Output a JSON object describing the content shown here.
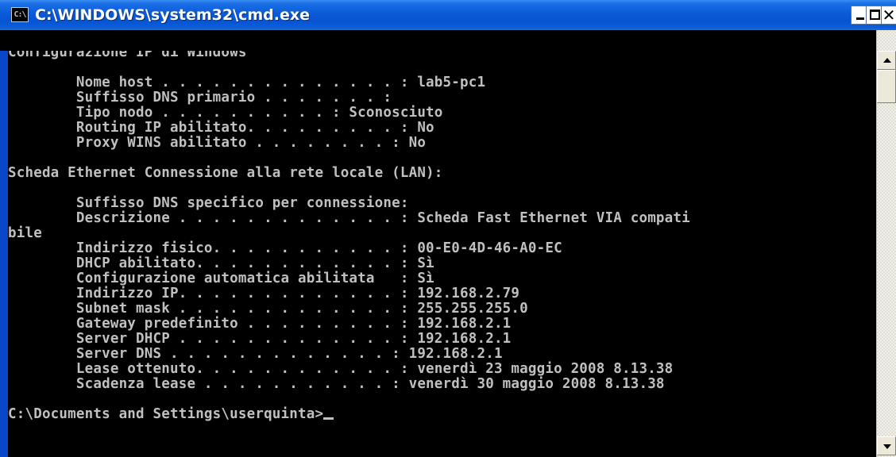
{
  "window": {
    "title": "C:\\WINDOWS\\system32\\cmd.exe",
    "icon_label": "C:\\",
    "icon": "cmd-app-icon",
    "controls": {
      "minimize_icon": "minimize-icon",
      "maximize_icon": "maximize-icon",
      "close_icon": "close-icon",
      "close_glyph": "✕"
    },
    "colors": {
      "title_bar": "#0753d0",
      "console_background": "#000000",
      "console_text": "#c0c0c0"
    }
  },
  "console": {
    "lines": [
      "",
      "Configurazione IP di Windows",
      "",
      "        Nome host . . . . . . . . . . . . . . : lab5-pc1",
      "        Suffisso DNS primario . . . . . . . :",
      "        Tipo nodo . . . . . . . . . . : Sconosciuto",
      "        Routing IP abilitato. . . . . . . . . : No",
      "        Proxy WINS abilitato . . . . . . . . : No",
      "",
      "Scheda Ethernet Connessione alla rete locale (LAN):",
      "",
      "        Suffisso DNS specifico per connessione:",
      "        Descrizione . . . . . . . . . . . . . : Scheda Fast Ethernet VIA compati",
      "bile",
      "        Indirizzo fisico. . . . . . . . . . . : 00-E0-4D-46-A0-EC",
      "        DHCP abilitato. . . . . . . . . . . . : Sì",
      "        Configurazione automatica abilitata   : Sì",
      "        Indirizzo IP. . . . . . . . . . . . . : 192.168.2.79",
      "        Subnet mask . . . . . . . . . . . . . : 255.255.255.0",
      "        Gateway predefinito . . . . . . . . . : 192.168.2.1",
      "        Server DHCP . . . . . . . . . . . . . : 192.168.2.1",
      "        Server DNS . . . . . . . . . . . . . : 192.168.2.1",
      "        Lease ottenuto. . . . . . . . . . . . : venerdì 23 maggio 2008 8.13.38",
      "        Scadenza lease . . . . . . . . . . . : venerdì 30 maggio 2008 8.13.38",
      ""
    ],
    "prompt": "C:\\Documents and Settings\\userquinta>"
  },
  "scrollbar": {
    "up_icon": "scroll-up-arrow-icon",
    "down_icon": "scroll-down-arrow-icon"
  }
}
